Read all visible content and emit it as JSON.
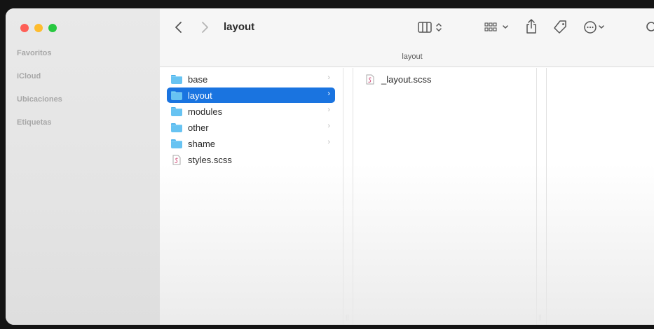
{
  "sidebar": {
    "sections": [
      "Favoritos",
      "iCloud",
      "Ubicaciones",
      "Etiquetas"
    ]
  },
  "toolbar": {
    "title": "layout",
    "back_icon": "chevron-left-icon",
    "forward_icon": "chevron-right-icon",
    "view_icon": "columns-view-icon",
    "group_icon": "grid-group-icon",
    "share_icon": "share-icon",
    "tag_icon": "tag-icon",
    "more_icon": "ellipsis-circle-icon",
    "search_icon": "search-icon"
  },
  "pathbar": {
    "label": "layout"
  },
  "columns": {
    "first": [
      {
        "name": "base",
        "kind": "folder"
      },
      {
        "name": "layout",
        "kind": "folder",
        "selected": true
      },
      {
        "name": "modules",
        "kind": "folder"
      },
      {
        "name": "other",
        "kind": "folder"
      },
      {
        "name": "shame",
        "kind": "folder"
      },
      {
        "name": "styles.scss",
        "kind": "file"
      }
    ],
    "second": [
      {
        "name": "_layout.scss",
        "kind": "file"
      }
    ]
  },
  "colors": {
    "selection": "#1a74e0",
    "folder": "#67c3f2",
    "traffic_red": "#fe5f57",
    "traffic_yellow": "#febc2e",
    "traffic_green": "#28c840"
  }
}
